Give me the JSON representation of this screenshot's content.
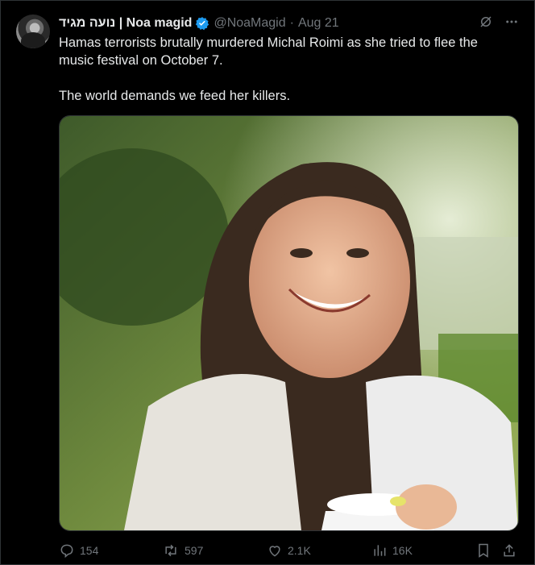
{
  "tweet": {
    "author_name": "נועה מגיד | Noa magid",
    "handle": "@NoaMagid",
    "separator": "·",
    "date": "Aug 21",
    "paragraphs": [
      "Hamas terrorists brutally murdered Michal Roimi as she tried to flee the music festival on October 7.",
      "The world demands we feed her killers."
    ]
  },
  "actions": {
    "replies": "154",
    "reposts": "597",
    "likes": "2.1K",
    "views": "16K"
  },
  "icons": [
    "grok-icon",
    "more-icon",
    "verified-badge-icon",
    "reply-icon",
    "repost-icon",
    "like-icon",
    "views-icon",
    "bookmark-icon",
    "share-icon"
  ],
  "colors": {
    "verified": "#1d9bf0",
    "muted": "#71767b",
    "text": "#e7e9ea"
  }
}
